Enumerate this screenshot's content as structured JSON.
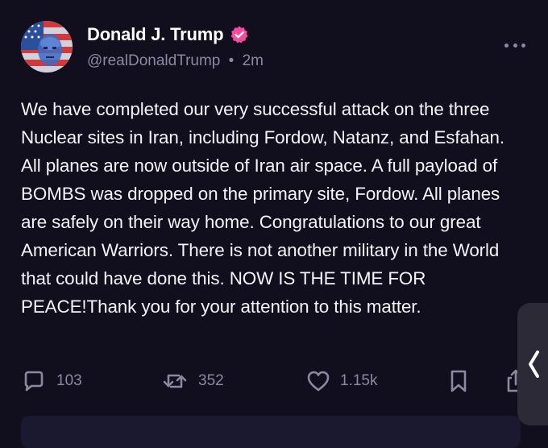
{
  "author": {
    "display_name": "Donald J. Trump",
    "handle": "@realDonaldTrump",
    "separator": "•",
    "timestamp": "2m",
    "verified": true,
    "verified_color": "#ff4aa0"
  },
  "post": {
    "text": "We have completed our very successful attack on the three Nuclear sites in Iran, including Fordow, Natanz, and Esfahan. All planes are now outside of Iran air space. A full payload of BOMBS was dropped on the primary site, Fordow. All planes are safely on their way home. Congratulations to our great American Warriors. There is not another military in the World that could have done this. NOW IS THE TIME FOR PEACE!Thank you for your attention to this matter."
  },
  "actions": {
    "replies": {
      "icon": "reply-icon",
      "count": "103"
    },
    "reposts": {
      "icon": "repost-icon",
      "count": "352"
    },
    "likes": {
      "icon": "heart-icon",
      "count": "1.15k"
    },
    "bookmark": {
      "icon": "bookmark-icon"
    },
    "share": {
      "icon": "share-icon"
    }
  },
  "menu": {
    "icon": "more-options-icon"
  },
  "side_tab": {
    "icon": "chevron-left-icon"
  },
  "colors": {
    "background": "#110f1e",
    "text": "#f4f3f8",
    "muted": "#8b88a0",
    "side_tab": "#2b2a36"
  }
}
